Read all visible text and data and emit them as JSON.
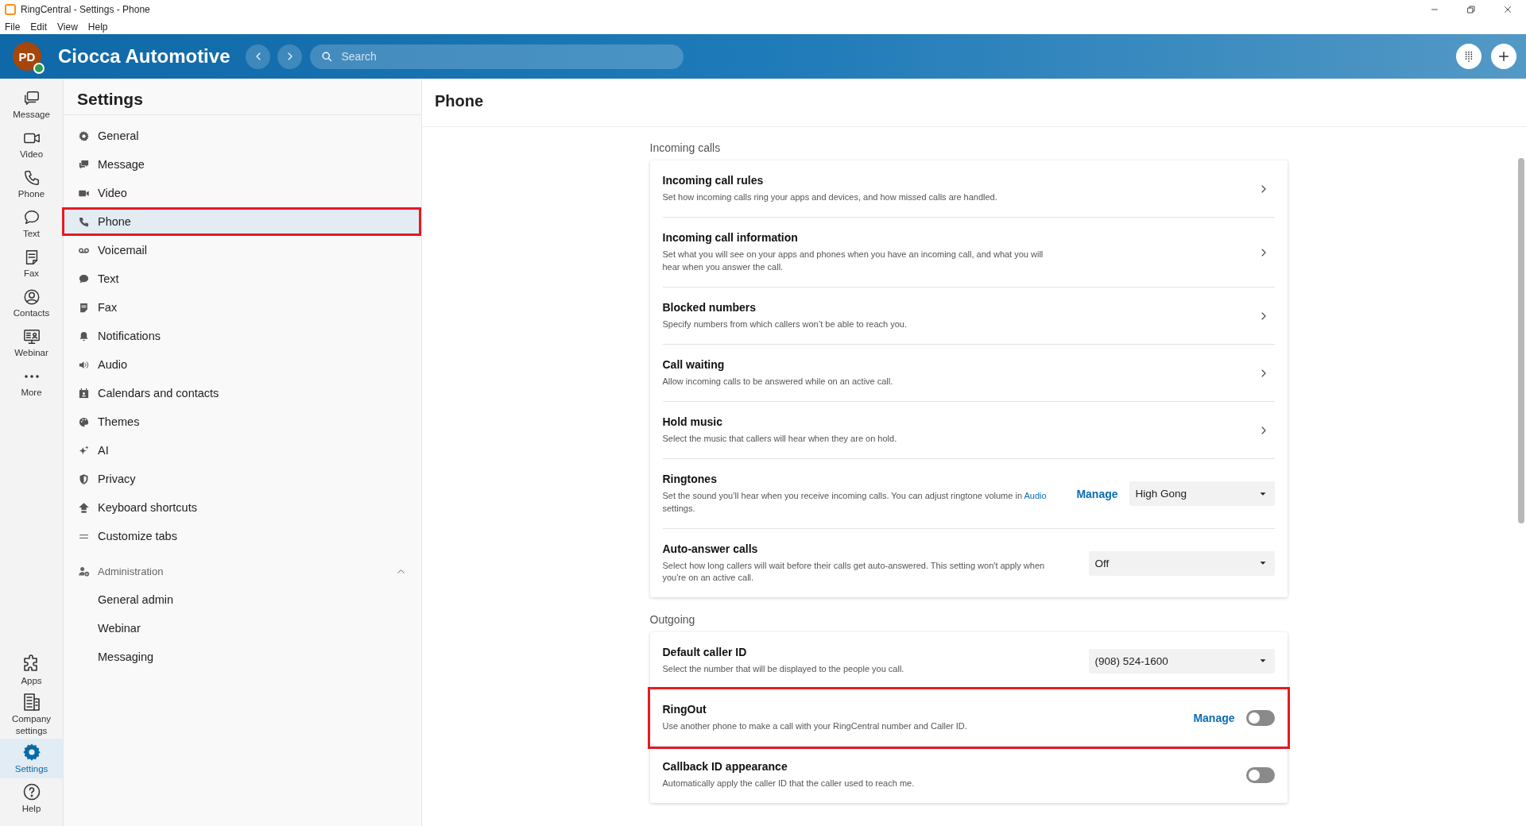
{
  "window": {
    "title": "RingCentral - Settings - Phone"
  },
  "menu": [
    "File",
    "Edit",
    "View",
    "Help"
  ],
  "header": {
    "avatar_initials": "PD",
    "org_name": "Ciocca Automotive",
    "search": {
      "placeholder": "Search"
    }
  },
  "rail": {
    "top": [
      {
        "label": "Message",
        "selected": false
      },
      {
        "label": "Video",
        "selected": false
      },
      {
        "label": "Phone",
        "selected": false
      },
      {
        "label": "Text",
        "selected": false
      },
      {
        "label": "Fax",
        "selected": false
      },
      {
        "label": "Contacts",
        "selected": false
      },
      {
        "label": "Webinar",
        "selected": false
      },
      {
        "label": "More",
        "selected": false
      }
    ],
    "bottom": [
      {
        "label": "Apps",
        "selected": false
      },
      {
        "label": "Company settings",
        "selected": false
      },
      {
        "label": "Settings",
        "selected": true
      },
      {
        "label": "Help",
        "selected": false
      }
    ]
  },
  "settings_nav": {
    "title": "Settings",
    "items": [
      {
        "label": "General",
        "selected": false,
        "highlighted": false
      },
      {
        "label": "Message",
        "selected": false,
        "highlighted": false
      },
      {
        "label": "Video",
        "selected": false,
        "highlighted": false
      },
      {
        "label": "Phone",
        "selected": true,
        "highlighted": true
      },
      {
        "label": "Voicemail",
        "selected": false,
        "highlighted": false
      },
      {
        "label": "Text",
        "selected": false,
        "highlighted": false
      },
      {
        "label": "Fax",
        "selected": false,
        "highlighted": false
      },
      {
        "label": "Notifications",
        "selected": false,
        "highlighted": false
      },
      {
        "label": "Audio",
        "selected": false,
        "highlighted": false
      },
      {
        "label": "Calendars and contacts",
        "selected": false,
        "highlighted": false
      },
      {
        "label": "Themes",
        "selected": false,
        "highlighted": false
      },
      {
        "label": "AI",
        "selected": false,
        "highlighted": false
      },
      {
        "label": "Privacy",
        "selected": false,
        "highlighted": false
      },
      {
        "label": "Keyboard shortcuts",
        "selected": false,
        "highlighted": false
      },
      {
        "label": "Customize tabs",
        "selected": false,
        "highlighted": false
      }
    ],
    "group": {
      "label": "Administration",
      "expanded": true,
      "children": [
        {
          "label": "General admin",
          "selected": false
        },
        {
          "label": "Webinar",
          "selected": false
        },
        {
          "label": "Messaging",
          "selected": false
        }
      ]
    }
  },
  "page": {
    "title": "Phone",
    "sections": [
      {
        "heading": "Incoming calls",
        "rows": [
          {
            "kind": "link",
            "title": "Incoming call rules",
            "description": "Set how incoming calls ring your apps and devices, and how missed calls are handled.",
            "highlighted": false
          },
          {
            "kind": "link",
            "title": "Incoming call information",
            "description": "Set what you will see on your apps and phones when you have an incoming call, and what you will hear when you answer the call.",
            "highlighted": false
          },
          {
            "kind": "link",
            "title": "Blocked numbers",
            "description": "Specify numbers from which callers won’t be able to reach you.",
            "highlighted": false
          },
          {
            "kind": "link",
            "title": "Call waiting",
            "description": "Allow incoming calls to be answered while on an active call.",
            "highlighted": false
          },
          {
            "kind": "link",
            "title": "Hold music",
            "description": "Select the music that callers will hear when they are on hold.",
            "highlighted": false
          },
          {
            "kind": "select",
            "title": "Ringtones",
            "description": "Set the sound you’ll hear when you receive incoming calls. You can adjust ringtone volume in",
            "description_link": "Audio",
            "description_after": "settings.",
            "manage": "Manage",
            "value": "High Gong",
            "highlighted": false
          },
          {
            "kind": "select",
            "title": "Auto-answer calls",
            "description": "Select how long callers will wait before their calls get auto-answered. This setting won't apply when you're on an active call.",
            "value": "Off",
            "highlighted": false
          }
        ]
      },
      {
        "heading": "Outgoing",
        "rows": [
          {
            "kind": "select",
            "title": "Default caller ID",
            "description": "Select the number that will be displayed to the people you call.",
            "value": "(908) 524-1600",
            "highlighted": false
          },
          {
            "kind": "toggle",
            "title": "RingOut",
            "description": "Use another phone to make a call with your RingCentral number and Caller ID.",
            "manage": "Manage",
            "on": false,
            "highlighted": true
          },
          {
            "kind": "toggle",
            "title": "Callback ID appearance",
            "description": "Automatically apply the caller ID that the caller used to reach me.",
            "on": false,
            "highlighted": false
          }
        ]
      }
    ]
  }
}
